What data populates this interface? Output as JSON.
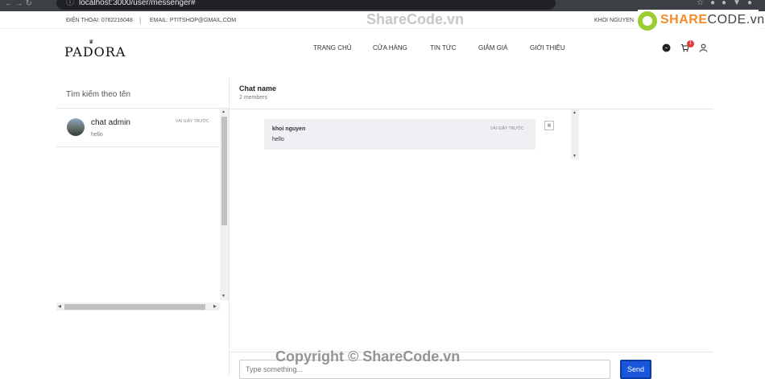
{
  "browser": {
    "url": "localhost:3000/user/messenger#"
  },
  "topbar": {
    "phone": "ĐIỆN THOẠI: 0762216048",
    "email": "EMAIL: PTITSHOP@GMAIL.COM",
    "user": "KHOI NGUYEN"
  },
  "brand": {
    "logo": "PADORA"
  },
  "nav": {
    "items": [
      {
        "label": "TRANG CHỦ"
      },
      {
        "label": "CỬA HÀNG"
      },
      {
        "label": "TIN TỨC"
      },
      {
        "label": "GIẢM GIÁ"
      },
      {
        "label": "GIỚI THIỆU"
      }
    ],
    "cart_count": "1"
  },
  "icons": {
    "messenger": "messenger-icon",
    "cart": "cart-icon",
    "user": "user-icon"
  },
  "sidebar": {
    "search_placeholder": "Tìm kiếm theo tên",
    "conversations": [
      {
        "name": "chat admin",
        "last_message": "hello",
        "time": "VÀI GIÂY TRƯỚC"
      }
    ]
  },
  "chat": {
    "title": "Chat name",
    "members": "2 members",
    "messages": [
      {
        "sender": "khoi nguyen",
        "text": "hello",
        "time": "VÀI GIÂY TRƯỚC"
      }
    ],
    "input_placeholder": "Type something...",
    "send_label": "Send"
  },
  "watermarks": {
    "top": "ShareCode.vn",
    "bottom": "Copyright © ShareCode.vn",
    "logo_brand": "SHARE",
    "logo_suffix": "CODE.vn"
  },
  "colors": {
    "send_button": "#1a56db",
    "badge": "#e03b3b",
    "bubble": "#eef0f4"
  }
}
